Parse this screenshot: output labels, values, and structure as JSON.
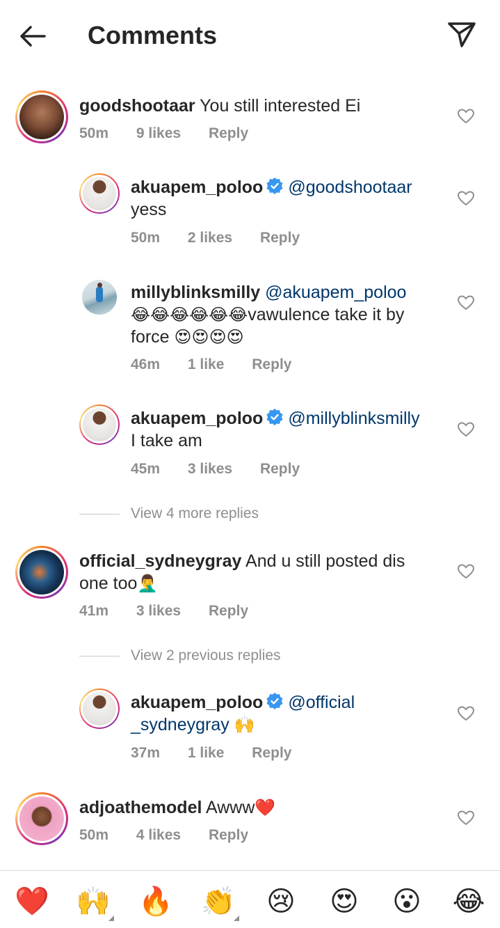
{
  "header": {
    "title": "Comments",
    "back_icon": "arrow-left-icon",
    "share_icon": "paper-plane-icon"
  },
  "comments": [
    {
      "username": "goodshootaar",
      "text": "You still interested Ei",
      "time": "50m",
      "likes": "9 likes",
      "reply": "Reply"
    },
    {
      "username": "akuapem_poloo",
      "mention": "@goodshootaar",
      "text": "yess",
      "time": "50m",
      "likes": "2 likes",
      "reply": "Reply"
    },
    {
      "username": "millyblinksmilly",
      "mention": "@akuapem_poloo",
      "text_emoji1": "😂😂😂😂😂😂",
      "text_mid": "vawulence take it by",
      "text_line3": "force ",
      "text_emoji2": "😍😍😍😍",
      "time": "46m",
      "likes": "1 like",
      "reply": "Reply"
    },
    {
      "username": "akuapem_poloo",
      "mention": "@millyblinksmilly",
      "text": "I take am",
      "time": "45m",
      "likes": "3 likes",
      "reply": "Reply"
    },
    {
      "username": "official_sydneygray",
      "text": "And u still posted dis",
      "text_line2": "one too",
      "text_emoji": "🤦‍♂️",
      "time": "41m",
      "likes": "3 likes",
      "reply": "Reply"
    },
    {
      "username": "akuapem_poloo",
      "mention_line1": "@official",
      "mention_line2": "_sydneygray",
      "text_emoji": "🙌",
      "time": "37m",
      "likes": "1 like",
      "reply": "Reply"
    },
    {
      "username": "adjoathemodel",
      "text": "Awww",
      "text_emoji": "❤️",
      "time": "50m",
      "likes": "4 likes",
      "reply": "Reply"
    }
  ],
  "view_more": {
    "more_replies": "View 4 more replies",
    "previous_replies": "View 2 previous replies"
  },
  "emoji_bar": [
    "❤️",
    "🙌",
    "🔥",
    "👏",
    "😢",
    "😍",
    "😮",
    "😂"
  ],
  "colors": {
    "text": "#262626",
    "secondary": "#8e8e8e",
    "mention": "#00376b",
    "verified": "#3897f0",
    "heart_red": "#ed4956"
  }
}
